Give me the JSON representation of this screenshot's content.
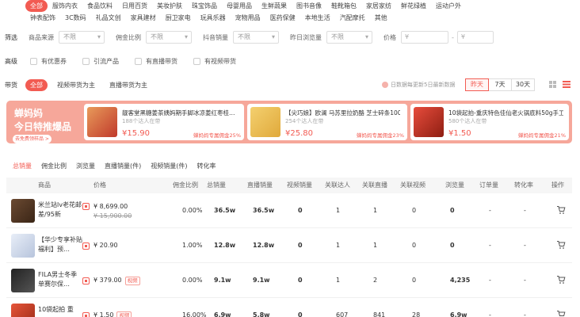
{
  "cat_row1": [
    "全部",
    "服饰内衣",
    "食品饮料",
    "日用百货",
    "美妆护肤",
    "珠宝饰品",
    "母婴用品",
    "生鲜蔬果",
    "图书音像",
    "鞋靴箱包",
    "家居家纺",
    "鲜花绿植",
    "运动户外"
  ],
  "cat_row2": [
    "钟表配饰",
    "3C数码",
    "礼品文创",
    "家具建材",
    "厨卫家电",
    "玩具乐器",
    "宠物用品",
    "医药保健",
    "本地生活",
    "汽配摩托",
    "其他"
  ],
  "filter": {
    "label": "筛选",
    "selects": [
      {
        "key": "商品来源",
        "value": "不限"
      },
      {
        "key": "佣金比例",
        "value": "不限"
      },
      {
        "key": "抖音销量",
        "value": "不限"
      },
      {
        "key": "昨日浏览量",
        "value": "不限"
      }
    ],
    "price_label": "价格",
    "price_min": "¥",
    "price_sep": "-",
    "price_max": "¥"
  },
  "advanced": {
    "label": "高级",
    "checks": [
      "有优惠券",
      "引流产品",
      "有直播带货",
      "有视频带货"
    ]
  },
  "goods": {
    "label": "带货",
    "chips": [
      "全部",
      "视频带货为主",
      "直播带货为主"
    ],
    "update_note": "日数据每更新5日最新数据",
    "ranges": [
      "昨天",
      "7天",
      "30天"
    ]
  },
  "banner": {
    "brand_line1": "蝉妈妈",
    "brand_line2": "今日特推爆品",
    "brand_btn": "去免费领样品 >",
    "cards": [
      {
        "title": "靓客堂黑糖姜茶姨妈期手脚冰凉姜红枣桂…",
        "sub": "188个达人在带",
        "price": "¥15.90",
        "comm": "蝉妈妈专属佣金25%"
      },
      {
        "title": "【尖巧娘】欧澜 马苏里拉奶酪 芝士碎条100…",
        "sub": "254个达人在带",
        "price": "¥25.80",
        "comm": "蝉妈妈专属佣金23%"
      },
      {
        "title": "10袋起拍-重庆特色佳仙老火锅底料50g手工…",
        "sub": "580个达人在带",
        "price": "¥1.50",
        "comm": "蝉妈妈专属佣金21%"
      }
    ]
  },
  "sort_tabs": [
    "总销量",
    "佣金比例",
    "浏览量",
    "直播销量(件)",
    "视频销量(件)",
    "转化率"
  ],
  "table": {
    "headers": [
      "商品",
      "价格",
      "佣金比例",
      "总销量",
      "直播销量",
      "视频销量",
      "关联达人",
      "关联直播",
      "关联视频",
      "浏览量",
      "订单量",
      "转化率",
      "操作"
    ],
    "rows": [
      {
        "name": "米兰站lv老花邮差/95新",
        "price": "¥ 8,699.00",
        "orig": "¥ 15,900.00",
        "badge": "",
        "comm": "0.00%",
        "total": "36.5w",
        "live": "36.5w",
        "video": "0",
        "kol": "1",
        "lives": "1",
        "videos": "0",
        "views": "0",
        "orders": "-",
        "cvr": "-"
      },
      {
        "name": "【华少专享补贴福利】预…",
        "price": "¥ 20.90",
        "orig": "",
        "badge": "",
        "comm": "1.00%",
        "total": "12.8w",
        "live": "12.8w",
        "video": "0",
        "kol": "1",
        "lives": "1",
        "videos": "0",
        "views": "0",
        "orders": "-",
        "cvr": "-"
      },
      {
        "name": "FILA男士冬季单赛尔保…",
        "price": "¥ 379.00",
        "orig": "",
        "badge": "视频",
        "comm": "0.00%",
        "total": "9.1w",
        "live": "9.1w",
        "video": "0",
        "kol": "1",
        "lives": "2",
        "videos": "0",
        "views": "4,235",
        "orders": "-",
        "cvr": "-"
      },
      {
        "name": "10袋起拍 重",
        "price": "¥ 1.50",
        "orig": "",
        "badge": "视频",
        "comm": "16.00%",
        "total": "6.9w",
        "live": "5.8w",
        "video": "0",
        "kol": "607",
        "lives": "841",
        "videos": "28",
        "views": "6.9w",
        "orders": "-",
        "cvr": "-"
      }
    ]
  }
}
